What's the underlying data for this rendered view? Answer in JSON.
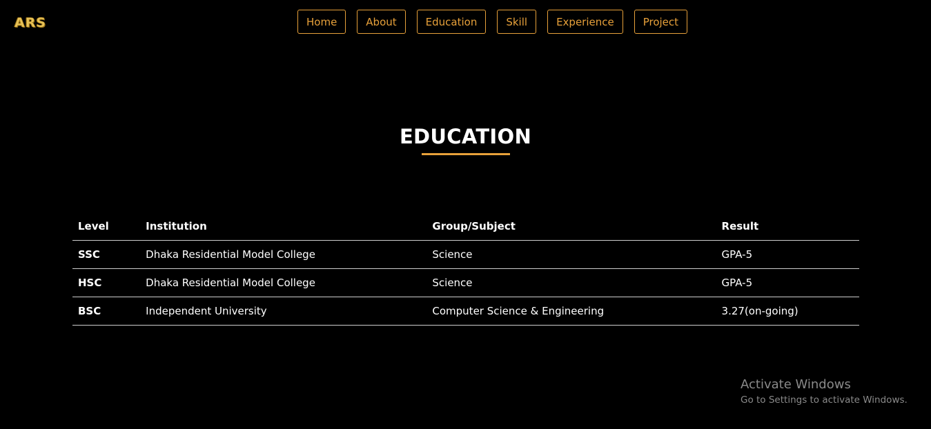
{
  "logo": {
    "text": "ARS"
  },
  "nav": {
    "items": [
      {
        "label": "Home"
      },
      {
        "label": "About"
      },
      {
        "label": "Education"
      },
      {
        "label": "Skill"
      },
      {
        "label": "Experience"
      },
      {
        "label": "Project"
      }
    ]
  },
  "section": {
    "title": "EDUCATION"
  },
  "table": {
    "headers": [
      "Level",
      "Institution",
      "Group/Subject",
      "Result"
    ],
    "rows": [
      {
        "level": "SSC",
        "institution": "Dhaka Residential Model College",
        "subject": "Science",
        "result": "GPA-5"
      },
      {
        "level": "HSC",
        "institution": "Dhaka Residential Model College",
        "subject": "Science",
        "result": "GPA-5"
      },
      {
        "level": "BSC",
        "institution": "Independent University",
        "subject": "Computer Science & Engineering",
        "result": "3.27(on-going)"
      }
    ]
  },
  "watermark": {
    "title": "Activate Windows",
    "subtitle": "Go to Settings to activate Windows."
  },
  "colors": {
    "background": "#000000",
    "accent": "#e8a13a",
    "logo": "#e7c35a",
    "text": "#ffffff",
    "watermark": "#8a8a8a"
  }
}
